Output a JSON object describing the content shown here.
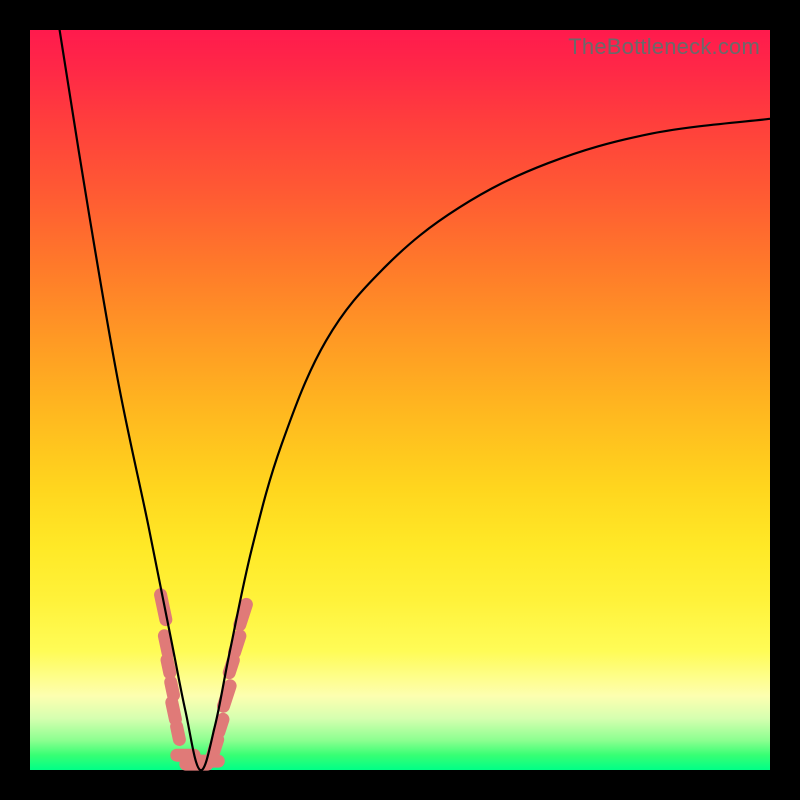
{
  "watermark": "TheBottleneck.com",
  "colors": {
    "frame": "#000000",
    "curve": "#000000",
    "cluster": "#e07a78",
    "gradient_top": "#ff1a4d",
    "gradient_bottom": "#00ff87"
  },
  "chart_data": {
    "type": "line",
    "title": "",
    "xlabel": "",
    "ylabel": "",
    "xlim": [
      0,
      100
    ],
    "ylim": [
      0,
      100
    ],
    "grid": false,
    "note": "V-shaped bottleneck curve; minimum near x≈23, y≈0. No numeric axis ticks shown. Values are visual estimates from curve geometry.",
    "series": [
      {
        "name": "bottleneck-curve",
        "x": [
          4,
          8,
          12,
          16,
          19,
          21,
          23,
          25,
          27,
          30,
          34,
          40,
          48,
          58,
          70,
          84,
          100
        ],
        "y": [
          100,
          75,
          52,
          33,
          18,
          8,
          0,
          6,
          16,
          30,
          44,
          58,
          68,
          76,
          82,
          86,
          88
        ]
      }
    ],
    "background_gradient": {
      "orientation": "vertical",
      "stops": [
        {
          "pos": 0.0,
          "color": "#ff1a4d"
        },
        {
          "pos": 0.32,
          "color": "#ff7a2a"
        },
        {
          "pos": 0.62,
          "color": "#ffd61e"
        },
        {
          "pos": 0.84,
          "color": "#fffc57"
        },
        {
          "pos": 0.93,
          "color": "#d6ffb0"
        },
        {
          "pos": 1.0,
          "color": "#00ff87"
        }
      ]
    },
    "cluster_points": {
      "comment": "Salmon lozenge markers near the curve minimum (approx positions, x/y in chart units)",
      "points": [
        {
          "x": 18.0,
          "y": 22,
          "len": 6
        },
        {
          "x": 18.4,
          "y": 17,
          "len": 4
        },
        {
          "x": 18.7,
          "y": 14,
          "len": 3
        },
        {
          "x": 19.2,
          "y": 11,
          "len": 3
        },
        {
          "x": 19.4,
          "y": 8,
          "len": 4
        },
        {
          "x": 20.0,
          "y": 5,
          "len": 3
        },
        {
          "x": 21.0,
          "y": 2,
          "len": 4
        },
        {
          "x": 22.5,
          "y": 0.8,
          "len": 5
        },
        {
          "x": 24.0,
          "y": 1.2,
          "len": 5
        },
        {
          "x": 25.0,
          "y": 3,
          "len": 4
        },
        {
          "x": 25.8,
          "y": 6,
          "len": 3
        },
        {
          "x": 26.6,
          "y": 10,
          "len": 5
        },
        {
          "x": 27.2,
          "y": 14,
          "len": 3
        },
        {
          "x": 28.0,
          "y": 17,
          "len": 4
        },
        {
          "x": 28.8,
          "y": 21,
          "len": 5
        }
      ]
    }
  }
}
